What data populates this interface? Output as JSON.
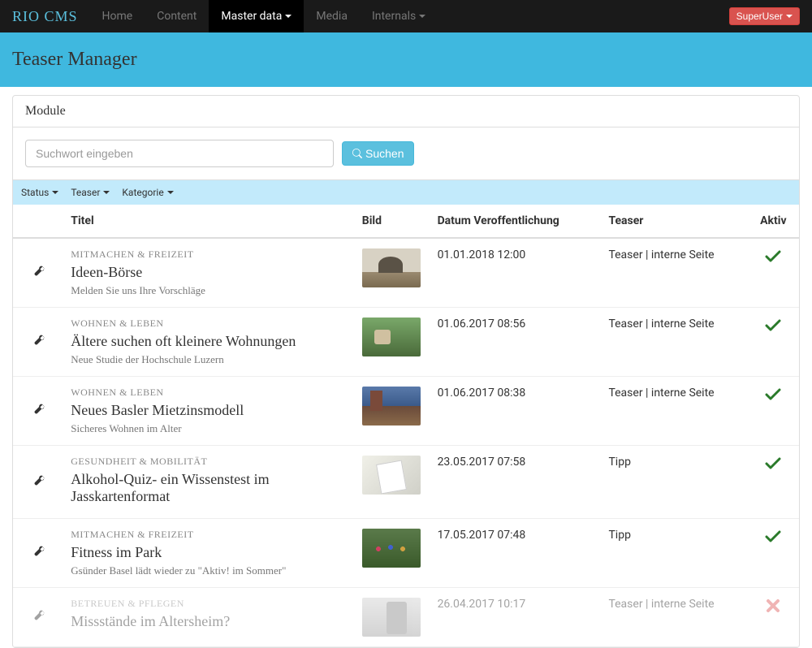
{
  "brand": "RIO CMS",
  "nav": {
    "home": "Home",
    "content": "Content",
    "master_data": "Master data",
    "media": "Media",
    "internals": "Internals"
  },
  "user_button": "SuperUser",
  "page_title": "Teaser Manager",
  "panel_title": "Module",
  "search": {
    "placeholder": "Suchwort eingeben",
    "button": "Suchen"
  },
  "filters": {
    "status": "Status",
    "teaser": "Teaser",
    "kategorie": "Kategorie"
  },
  "columns": {
    "titel": "Titel",
    "bild": "Bild",
    "datum": "Datum Veroffentlichung",
    "teaser": "Teaser",
    "aktiv": "Aktiv"
  },
  "rows": [
    {
      "category": "MITMACHEN & FREIZEIT",
      "title": "Ideen-Börse",
      "subtitle": "Melden Sie uns Ihre Vorschläge",
      "date": "01.01.2018 12:00",
      "teaser": "Teaser | interne Seite",
      "active": true
    },
    {
      "category": "WOHNEN & LEBEN",
      "title": "Ältere suchen oft kleinere Wohnungen",
      "subtitle": "Neue Studie der Hochschule Luzern",
      "date": "01.06.2017 08:56",
      "teaser": "Teaser | interne Seite",
      "active": true
    },
    {
      "category": "WOHNEN & LEBEN",
      "title": "Neues Basler Mietzinsmodell",
      "subtitle": "Sicheres Wohnen im Alter",
      "date": "01.06.2017 08:38",
      "teaser": "Teaser | interne Seite",
      "active": true
    },
    {
      "category": "GESUNDHEIT & MOBILITÄT",
      "title": "Alkohol-Quiz- ein Wissenstest im Jasskartenformat",
      "subtitle": "",
      "date": "23.05.2017 07:58",
      "teaser": "Tipp",
      "active": true
    },
    {
      "category": "MITMACHEN & FREIZEIT",
      "title": "Fitness im Park",
      "subtitle": "Gsünder Basel lädt wieder zu \"Aktiv! im Sommer\"",
      "date": "17.05.2017 07:48",
      "teaser": "Tipp",
      "active": true
    },
    {
      "category": "BETREUEN & PFLEGEN",
      "title": "Missstände im Altersheim?",
      "subtitle": "",
      "date": "26.04.2017 10:17",
      "teaser": "Teaser | interne Seite",
      "active": false
    }
  ]
}
